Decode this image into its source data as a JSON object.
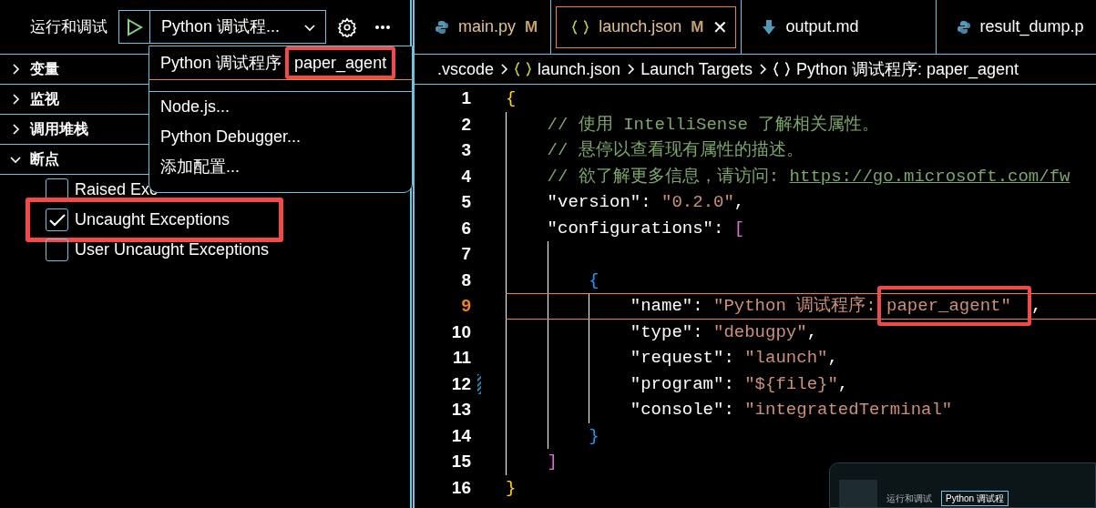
{
  "sidebar": {
    "title": "运行和调试",
    "config_label": "Python 调试程...",
    "sections": [
      {
        "label": "变量",
        "expanded": false
      },
      {
        "label": "监视",
        "expanded": false
      },
      {
        "label": "调用堆栈",
        "expanded": false
      },
      {
        "label": "断点",
        "expanded": true
      }
    ],
    "breakpoints": [
      {
        "label": "Raised Exc",
        "checked": false,
        "highlighted": false
      },
      {
        "label": "Uncaught Exceptions",
        "checked": true,
        "highlighted": true
      },
      {
        "label": "User Uncaught Exceptions",
        "checked": false,
        "highlighted": false
      }
    ]
  },
  "config_menu": {
    "items": [
      {
        "label": "Python 调试程序",
        "detail": "paper_agent",
        "selected": true,
        "highlighted": true
      },
      {
        "label": "Node.js...",
        "selected": false,
        "highlighted": false
      },
      {
        "label": "Python Debugger...",
        "selected": false,
        "highlighted": false
      },
      {
        "label": "添加配置...",
        "selected": false,
        "highlighted": false
      }
    ]
  },
  "tabs": [
    {
      "kind": "python",
      "label": "main.py",
      "badge": "M",
      "selected": false,
      "modified": true
    },
    {
      "kind": "json",
      "label": "launch.json",
      "badge": "M",
      "close": "✕",
      "selected": true,
      "modified": true
    },
    {
      "kind": "markdown",
      "label": "output.md",
      "selected": false,
      "modified": false
    },
    {
      "kind": "python",
      "label": "result_dump.p",
      "selected": false,
      "modified": false
    }
  ],
  "breadcrumb": [
    {
      "kind": "folder",
      "label": ".vscode"
    },
    {
      "kind": "json",
      "label": "launch.json"
    },
    {
      "kind": "folder",
      "label": "Launch Targets"
    },
    {
      "kind": "object",
      "label": "Python 调试程序: paper_agent"
    }
  ],
  "editor": {
    "lines": [
      {
        "number": "1",
        "current": false,
        "modified": false,
        "tokens": [
          {
            "kind": "bracket",
            "text": "{",
            "color": "#ffd700"
          }
        ]
      },
      {
        "number": "2",
        "current": false,
        "modified": false,
        "tokens": [
          {
            "kind": "comment",
            "text": "// 使用 IntelliSense 了解相关属性。"
          }
        ]
      },
      {
        "number": "3",
        "current": false,
        "modified": false,
        "tokens": [
          {
            "kind": "comment",
            "text": "// 悬停以查看现有属性的描述。"
          }
        ]
      },
      {
        "number": "4",
        "current": false,
        "modified": false,
        "tokens": [
          {
            "kind": "comment",
            "text": "// 欲了解更多信息，请访问: "
          },
          {
            "kind": "link",
            "text": "https://go.microsoft.com/fw"
          }
        ]
      },
      {
        "number": "5",
        "current": false,
        "modified": false,
        "tokens": [
          {
            "kind": "key",
            "text": "\"version\""
          },
          {
            "kind": "punct",
            "text": ": "
          },
          {
            "kind": "string",
            "text": "\"0.2.0\""
          },
          {
            "kind": "punct",
            "text": ","
          }
        ]
      },
      {
        "number": "6",
        "current": false,
        "modified": false,
        "tokens": [
          {
            "kind": "key",
            "text": "\"configurations\""
          },
          {
            "kind": "punct",
            "text": ": "
          },
          {
            "kind": "bracket",
            "text": "[",
            "color": "#da70d6"
          }
        ]
      },
      {
        "number": "7",
        "current": false,
        "modified": false
      },
      {
        "number": "8",
        "current": false,
        "modified": false,
        "tokens": [
          {
            "kind": "bracket",
            "text": "{",
            "color": "#179fff"
          }
        ]
      },
      {
        "number": "9",
        "current": true,
        "modified": false,
        "tokens": [
          {
            "kind": "key",
            "text": "\"name\""
          },
          {
            "kind": "punct",
            "text": ": "
          },
          {
            "kind": "string",
            "text": "\"Python 调试程序: "
          },
          {
            "kind": "marked",
            "text": "paper_agent\""
          },
          {
            "kind": "punct",
            "text": ","
          }
        ]
      },
      {
        "number": "10",
        "current": false,
        "modified": false,
        "tokens": [
          {
            "kind": "key",
            "text": "\"type\""
          },
          {
            "kind": "punct",
            "text": ": "
          },
          {
            "kind": "string",
            "text": "\"debugpy\""
          },
          {
            "kind": "punct",
            "text": ","
          }
        ]
      },
      {
        "number": "11",
        "current": false,
        "modified": false,
        "tokens": [
          {
            "kind": "key",
            "text": "\"request\""
          },
          {
            "kind": "punct",
            "text": ": "
          },
          {
            "kind": "string",
            "text": "\"launch\""
          },
          {
            "kind": "punct",
            "text": ","
          }
        ]
      },
      {
        "number": "12",
        "current": false,
        "modified": true,
        "tokens": [
          {
            "kind": "key",
            "text": "\"program\""
          },
          {
            "kind": "punct",
            "text": ": "
          },
          {
            "kind": "string",
            "text": "\"${file}\""
          },
          {
            "kind": "punct",
            "text": ","
          }
        ]
      },
      {
        "number": "13",
        "current": false,
        "modified": false,
        "tokens": [
          {
            "kind": "key",
            "text": "\"console\""
          },
          {
            "kind": "punct",
            "text": ": "
          },
          {
            "kind": "string",
            "text": "\"integratedTerminal\""
          }
        ]
      },
      {
        "number": "14",
        "current": false,
        "modified": false,
        "tokens": [
          {
            "kind": "bracket",
            "text": "}",
            "color": "#179fff"
          }
        ]
      },
      {
        "number": "15",
        "current": false,
        "modified": false,
        "tokens": [
          {
            "kind": "bracket",
            "text": "]",
            "color": "#da70d6"
          }
        ]
      },
      {
        "number": "16",
        "current": false,
        "modified": false,
        "tokens": [
          {
            "kind": "bracket",
            "text": "}",
            "color": "#ffd700"
          }
        ]
      }
    ]
  },
  "thumbnail": {
    "title": "运行和调试",
    "config_label": "Python 调试程"
  }
}
